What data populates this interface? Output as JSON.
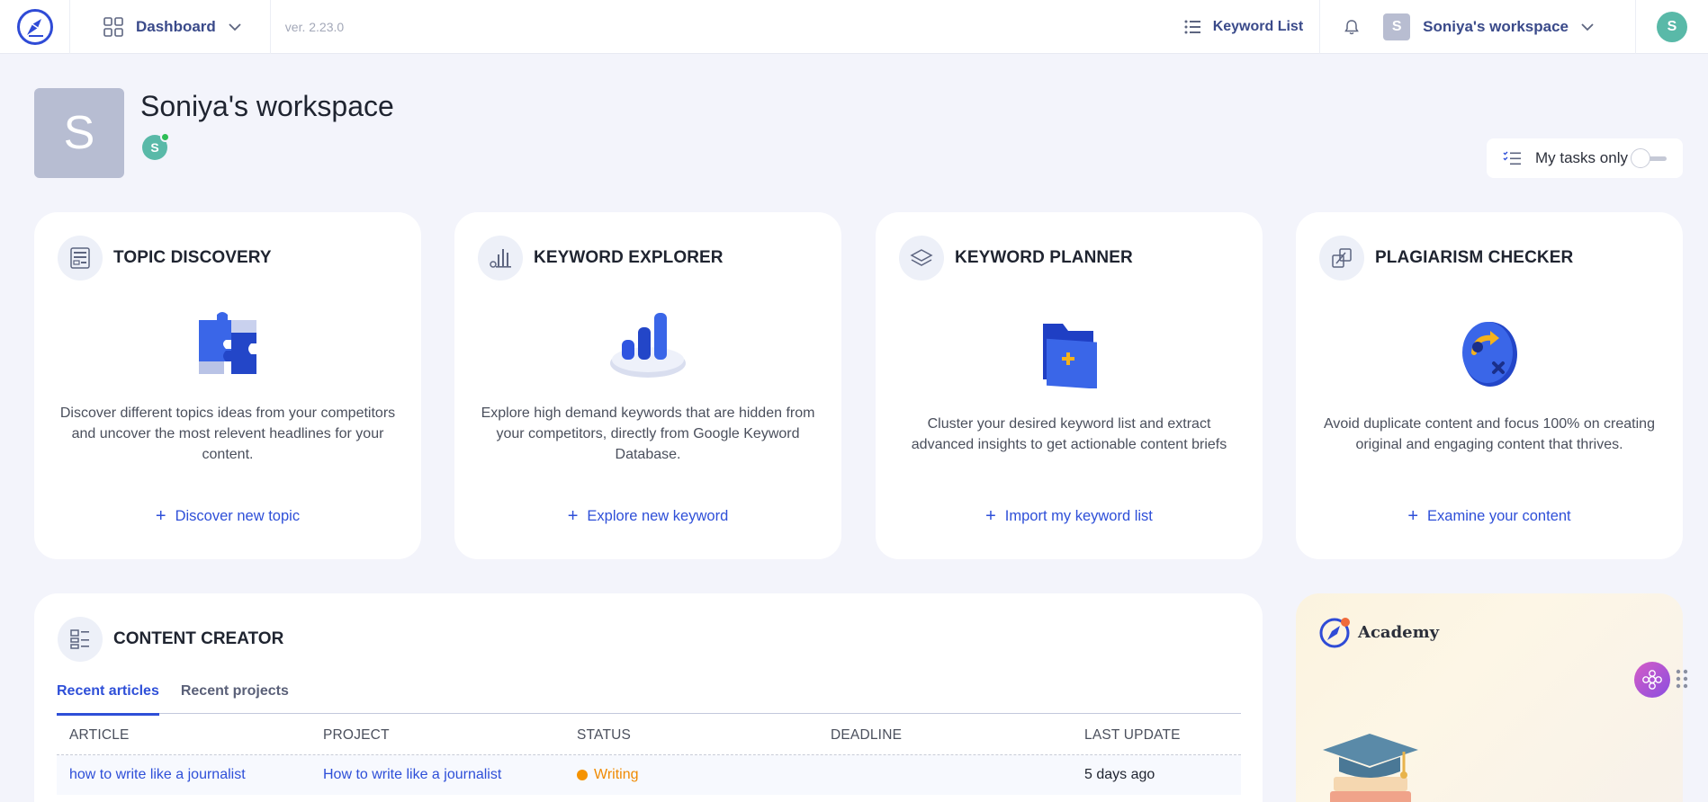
{
  "topbar": {
    "nav_label": "Dashboard",
    "version": "ver. 2.23.0",
    "keyword_list_label": "Keyword List",
    "workspace_badge": "S",
    "workspace_name": "Soniya's workspace",
    "user_initial": "S"
  },
  "workspace": {
    "avatar_letter": "S",
    "title": "Soniya's workspace",
    "member_initial": "S"
  },
  "tasks_toggle": {
    "label": "My tasks only",
    "enabled": false
  },
  "cards": [
    {
      "title": "TOPIC DISCOVERY",
      "description": "Discover different topics ideas from your competitors and uncover the most relevent headlines for your content.",
      "action": "Discover new topic",
      "icon": "topic-discovery-icon"
    },
    {
      "title": "KEYWORD EXPLORER",
      "description": "Explore high demand keywords that are hidden from your competitors, directly from Google Keyword Database.",
      "action": "Explore new keyword",
      "icon": "keyword-explorer-icon"
    },
    {
      "title": "KEYWORD PLANNER",
      "description": "Cluster your desired keyword list and extract advanced insights to get actionable content briefs",
      "action": "Import my keyword list",
      "icon": "keyword-planner-icon"
    },
    {
      "title": "PLAGIARISM CHECKER",
      "description": "Avoid duplicate content and focus 100% on creating original and engaging content that thrives.",
      "action": "Examine your content",
      "icon": "plagiarism-checker-icon"
    }
  ],
  "content_creator": {
    "title": "CONTENT CREATOR",
    "tabs": [
      "Recent articles",
      "Recent projects"
    ],
    "active_tab": "Recent articles",
    "columns": [
      "ARTICLE",
      "PROJECT",
      "STATUS",
      "DEADLINE",
      "LAST UPDATE"
    ],
    "rows": [
      {
        "article": "how to write like a journalist",
        "project": "How to write like a journalist",
        "status": "Writing",
        "deadline": "",
        "last_update": "5 days ago"
      }
    ]
  },
  "academy": {
    "brand": "Academy"
  },
  "colors": {
    "primary": "#2e4fd8",
    "background": "#f3f4fb",
    "status_writing": "#f59300",
    "avatar_teal": "#59b9a8",
    "online": "#2dbd55"
  }
}
